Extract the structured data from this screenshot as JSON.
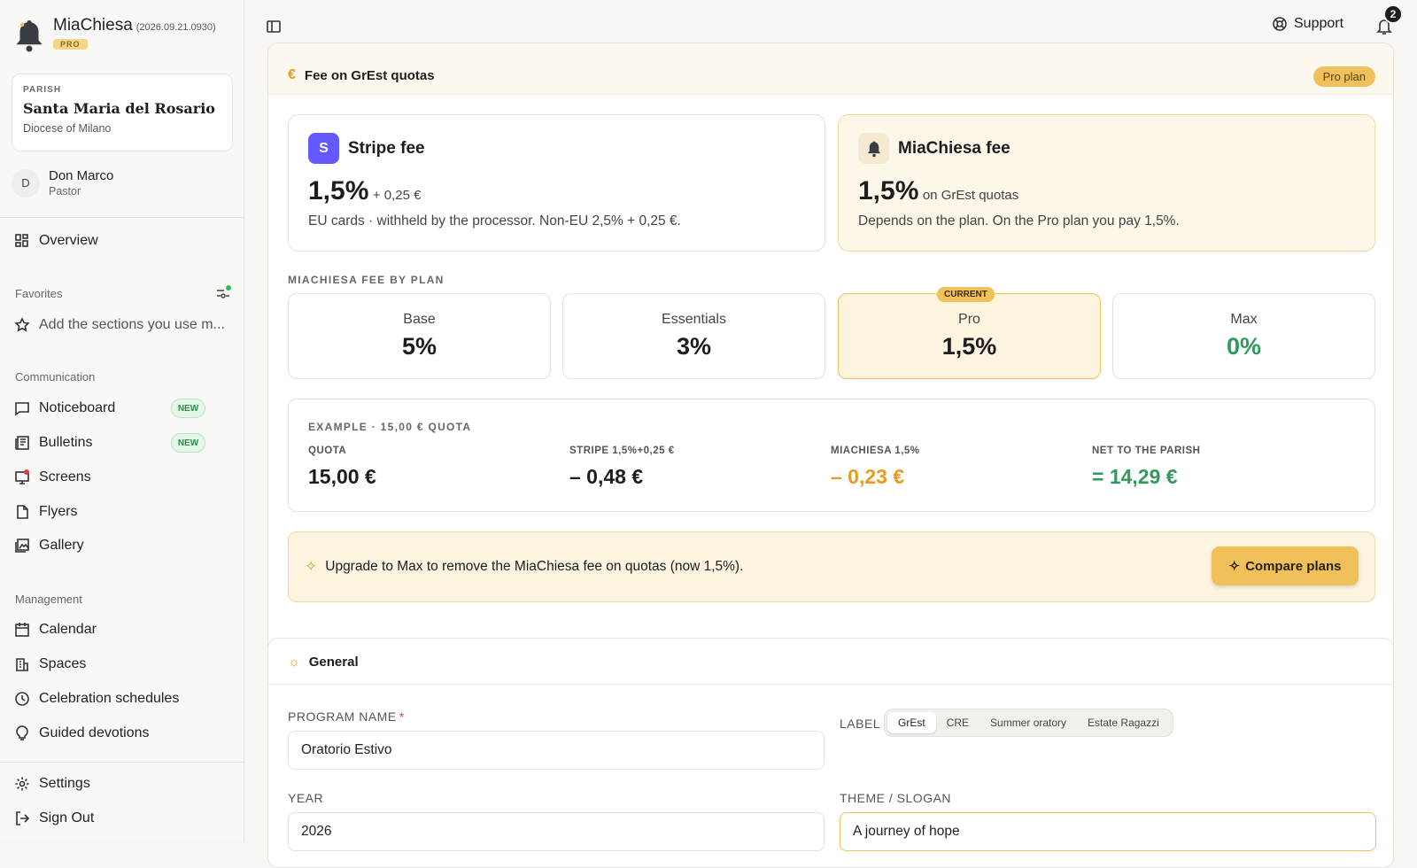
{
  "app": {
    "name": "MiaChiesa",
    "version": "(2026.09.21.0930)",
    "plan_tag": "PRO"
  },
  "parish": {
    "label": "PARISH",
    "name": "Santa Maria del Rosario",
    "diocese": "Diocese of Milano"
  },
  "user": {
    "initial": "D",
    "name": "Don Marco",
    "role": "Pastor"
  },
  "nav": {
    "overview": "Overview",
    "favorites_title": "Favorites",
    "favorites_hint": "Add the sections you use m...",
    "communication_title": "Communication",
    "noticeboard": "Noticeboard",
    "bulletins": "Bulletins",
    "screens": "Screens",
    "flyers": "Flyers",
    "gallery": "Gallery",
    "new_badge": "NEW",
    "management_title": "Management",
    "calendar": "Calendar",
    "spaces": "Spaces",
    "celebration": "Celebration schedules",
    "devotions": "Guided devotions",
    "settings": "Settings",
    "signout": "Sign Out"
  },
  "topbar": {
    "support": "Support",
    "notif_count": "2"
  },
  "fee_section": {
    "title": "Fee on GrEst quotas",
    "plan_pill": "Pro plan",
    "stripe": {
      "initial": "S",
      "title": "Stripe fee",
      "big": "1,5%",
      "small": "+ 0,25 €",
      "desc": "EU cards · withheld by the processor. Non-EU 2,5% + 0,25 €."
    },
    "miachiesa": {
      "title": "MiaChiesa fee",
      "big": "1,5%",
      "small": "on GrEst quotas",
      "desc": "Depends on the plan. On the Pro plan you pay 1,5%."
    },
    "by_plan_label": "MIACHIESA FEE BY PLAN",
    "plans": [
      {
        "name": "Base",
        "value": "5%"
      },
      {
        "name": "Essentials",
        "value": "3%"
      },
      {
        "name": "Pro",
        "value": "1,5%",
        "current": "CURRENT"
      },
      {
        "name": "Max",
        "value": "0%"
      }
    ],
    "example": {
      "title": "EXAMPLE · 15,00 € QUOTA",
      "cols": [
        {
          "label": "QUOTA",
          "value": "15,00 €"
        },
        {
          "label": "STRIPE 1,5%+0,25 €",
          "value": "– 0,48 €"
        },
        {
          "label": "MIACHIESA 1,5%",
          "value": "– 0,23 €"
        },
        {
          "label": "NET TO THE PARISH",
          "value": "= 14,29 €"
        }
      ]
    },
    "upgrade_text": "Upgrade to Max to remove the MiaChiesa fee on quotas (now 1,5%).",
    "compare_btn": "Compare plans"
  },
  "general": {
    "title": "General",
    "program_label": "PROGRAM NAME",
    "required_mark": "*",
    "program_value": "Oratorio Estivo",
    "label_label": "LABEL",
    "label_options": [
      "GrEst",
      "CRE",
      "Summer oratory",
      "Estate Ragazzi"
    ],
    "year_label": "YEAR",
    "year_value": "2026",
    "theme_label": "THEME / SLOGAN",
    "theme_value": "A journey of hope"
  },
  "colors": {
    "accent": "#f0c15b",
    "stripe_purple": "#6359ff",
    "orange": "#e79a1f",
    "green": "#2f9a5b",
    "red_dot": "#e23b3b",
    "green_dot": "#29c25a"
  }
}
